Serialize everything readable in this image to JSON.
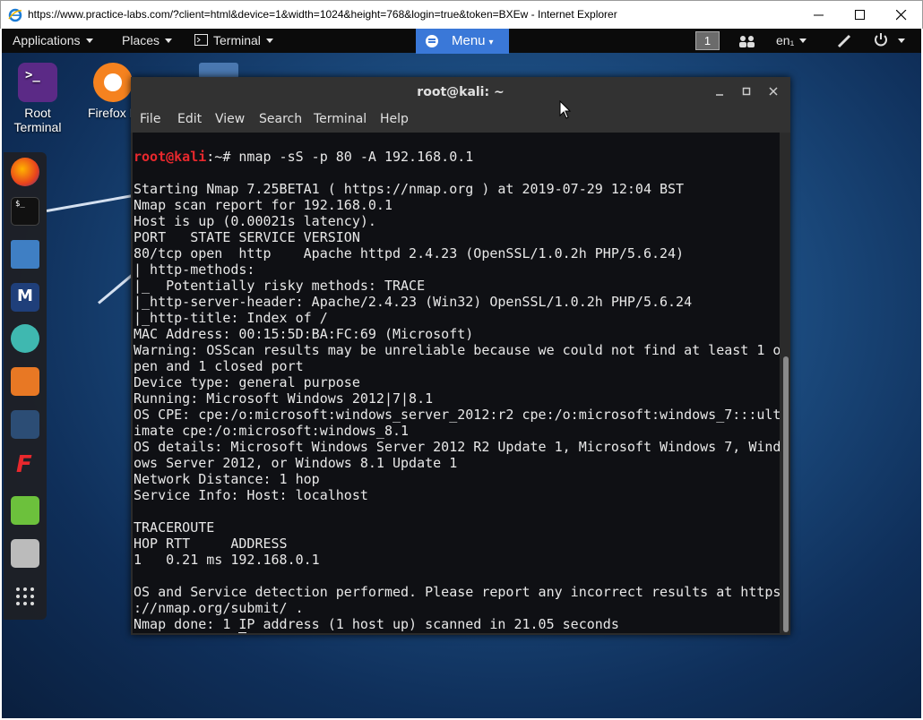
{
  "browser": {
    "title": "https://www.practice-labs.com/?client=html&device=1&width=1024&height=768&login=true&token=BXEw - Internet Explorer",
    "icon": "ie-icon"
  },
  "top_panel": {
    "applications": "Applications",
    "places": "Places",
    "terminal": "Terminal",
    "menu": "Menu",
    "workspace": "1",
    "language": "en₁"
  },
  "desktop_icons": [
    {
      "label_line1": "Root",
      "label_line2": "Terminal"
    },
    {
      "label_line1": "Firefox E",
      "label_line2": ""
    }
  ],
  "dock": [
    "firefox-icon",
    "terminal-icon",
    "files-icon",
    "metasploit-icon",
    "armitage-icon",
    "burpsuite-icon",
    "maltego-icon",
    "faraday-icon",
    "leafpad-icon",
    "cutycapt-icon",
    "show-apps-icon"
  ],
  "terminal": {
    "title": "root@kali: ~",
    "menu": [
      "File",
      "Edit",
      "View",
      "Search",
      "Terminal",
      "Help"
    ],
    "prompt_user": "root@kali",
    "prompt_path": ":~# ",
    "command": "nmap -sS -p 80 -A 192.168.0.1",
    "output": [
      "",
      "Starting Nmap 7.25BETA1 ( https://nmap.org ) at 2019-07-29 12:04 BST",
      "Nmap scan report for 192.168.0.1",
      "Host is up (0.00021s latency).",
      "PORT   STATE SERVICE VERSION",
      "80/tcp open  http    Apache httpd 2.4.23 (OpenSSL/1.0.2h PHP/5.6.24)",
      "| http-methods:",
      "|_  Potentially risky methods: TRACE",
      "|_http-server-header: Apache/2.4.23 (Win32) OpenSSL/1.0.2h PHP/5.6.24",
      "|_http-title: Index of /",
      "MAC Address: 00:15:5D:BA:FC:69 (Microsoft)",
      "Warning: OSScan results may be unreliable because we could not find at least 1 o",
      "pen and 1 closed port",
      "Device type: general purpose",
      "Running: Microsoft Windows 2012|7|8.1",
      "OS CPE: cpe:/o:microsoft:windows_server_2012:r2 cpe:/o:microsoft:windows_7:::ult",
      "imate cpe:/o:microsoft:windows_8.1",
      "OS details: Microsoft Windows Server 2012 R2 Update 1, Microsoft Windows 7, Wind",
      "ows Server 2012, or Windows 8.1 Update 1",
      "Network Distance: 1 hop",
      "Service Info: Host: localhost",
      "",
      "TRACEROUTE",
      "HOP RTT     ADDRESS",
      "1   0.21 ms 192.168.0.1",
      "",
      "OS and Service detection performed. Please report any incorrect results at https",
      "://nmap.org/submit/ .",
      "Nmap done: 1 IP address (1 host up) scanned in 21.05 seconds"
    ]
  },
  "colors": {
    "prompt_red": "#e8282d",
    "menu_blue": "#3a78d8",
    "terminal_bg": "#0f1014"
  }
}
